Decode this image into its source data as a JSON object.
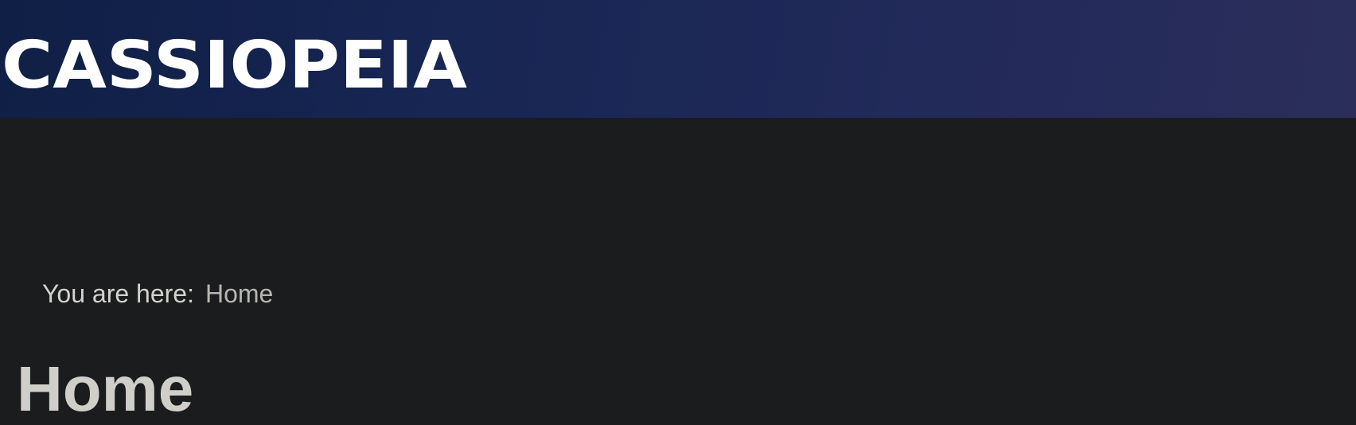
{
  "header": {
    "site_name": "CASSIOPEIA"
  },
  "breadcrumb": {
    "prefix": "You are here:",
    "current": "Home"
  },
  "page": {
    "title": "Home"
  },
  "colors": {
    "header_gradient_start": "#0f1f45",
    "header_gradient_end": "#2b2e5a",
    "page_background": "#1b1c1e",
    "title_text": "#d0cec8",
    "breadcrumb_text": "#d3d2cd",
    "breadcrumb_current": "#b8b6b0"
  }
}
